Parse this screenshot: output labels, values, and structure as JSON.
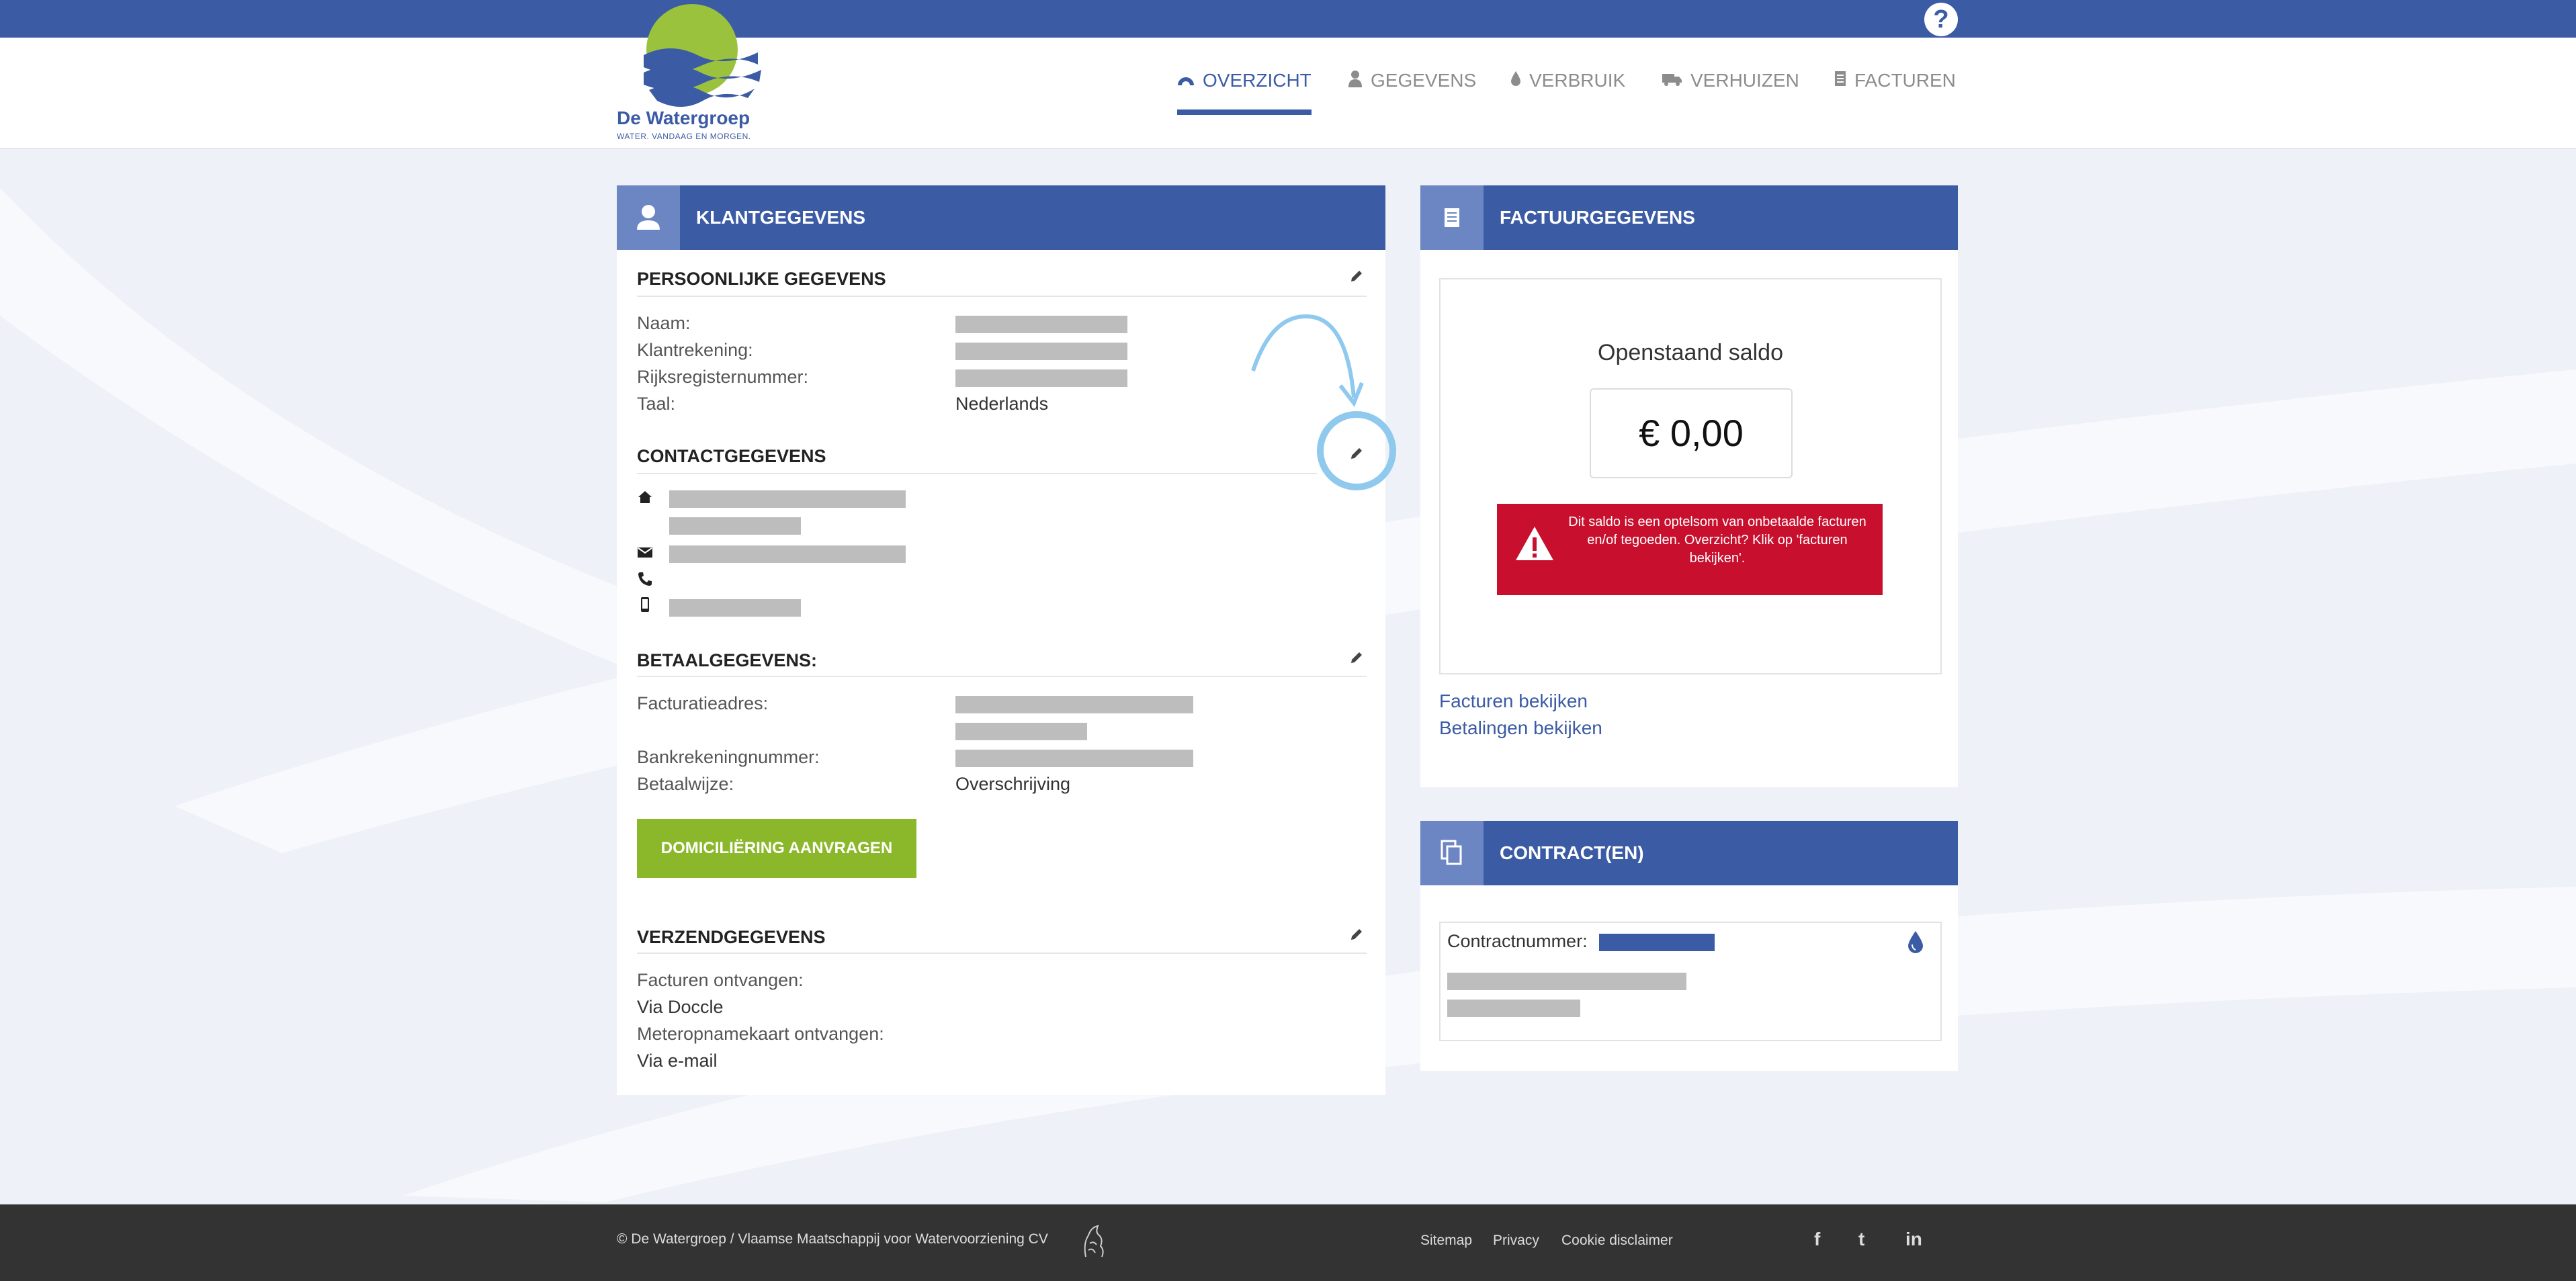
{
  "header": {
    "logo_name": "De Watergroep",
    "logo_tagline": "WATER. VANDAAG EN MORGEN.",
    "help_icon": "question-icon",
    "nav": [
      {
        "label": "OVERZICHT",
        "icon": "dashboard-icon",
        "active": true
      },
      {
        "label": "GEGEVENS",
        "icon": "user-icon"
      },
      {
        "label": "VERBRUIK",
        "icon": "drop-icon"
      },
      {
        "label": "VERHUIZEN",
        "icon": "truck-icon"
      },
      {
        "label": "FACTUREN",
        "icon": "document-icon"
      }
    ]
  },
  "klant": {
    "title": "KLANTGEGEVENS",
    "persoonlijk": {
      "title": "PERSOONLIJKE GEGEVENS",
      "naam_label": "Naam:",
      "klantrekening_label": "Klantrekening:",
      "rijksregister_label": "Rijksregisternummer:",
      "taal_label": "Taal:",
      "taal_value": "Nederlands"
    },
    "contact": {
      "title": "CONTACTGEGEVENS"
    },
    "betaal": {
      "title": "BETAALGEGEVENS:",
      "facturatie_label": "Facturatieadres:",
      "bank_label": "Bankrekeningnummer:",
      "wijze_label": "Betaalwijze:",
      "wijze_value": "Overschrijving",
      "button": "DOMICILIËRING AANVRAGEN"
    },
    "verzend": {
      "title": "VERZENDGEGEVENS",
      "facturen_label": "Facturen ontvangen:",
      "facturen_value": "Via Doccle",
      "meter_label": "Meteropnamekaart ontvangen:",
      "meter_value": "Via e-mail"
    }
  },
  "factuur": {
    "title": "FACTUURGEGEVENS",
    "saldo_title": "Openstaand saldo",
    "amount": "€ 0,00",
    "alert": "Dit saldo is een optelsom van onbetaalde facturen en/of tegoeden. Overzicht? Klik op 'facturen bekijken'.",
    "link_facturen": "Facturen bekijken",
    "link_betalingen": "Betalingen bekijken"
  },
  "contract": {
    "title": "CONTRACT(EN)",
    "nummer_label": "Contractnummer:"
  },
  "footer": {
    "copyright": "© De Watergroep / Vlaamse Maatschappij voor Watervoorziening CV",
    "links": [
      "Sitemap",
      "Privacy",
      "Cookie disclaimer"
    ],
    "social": [
      "f",
      "t",
      "in"
    ]
  },
  "colors": {
    "brand": "#3b5ba5",
    "accent_green": "#8bb82b",
    "alert_red": "#c8102e",
    "highlight": "#8fc9ee"
  }
}
